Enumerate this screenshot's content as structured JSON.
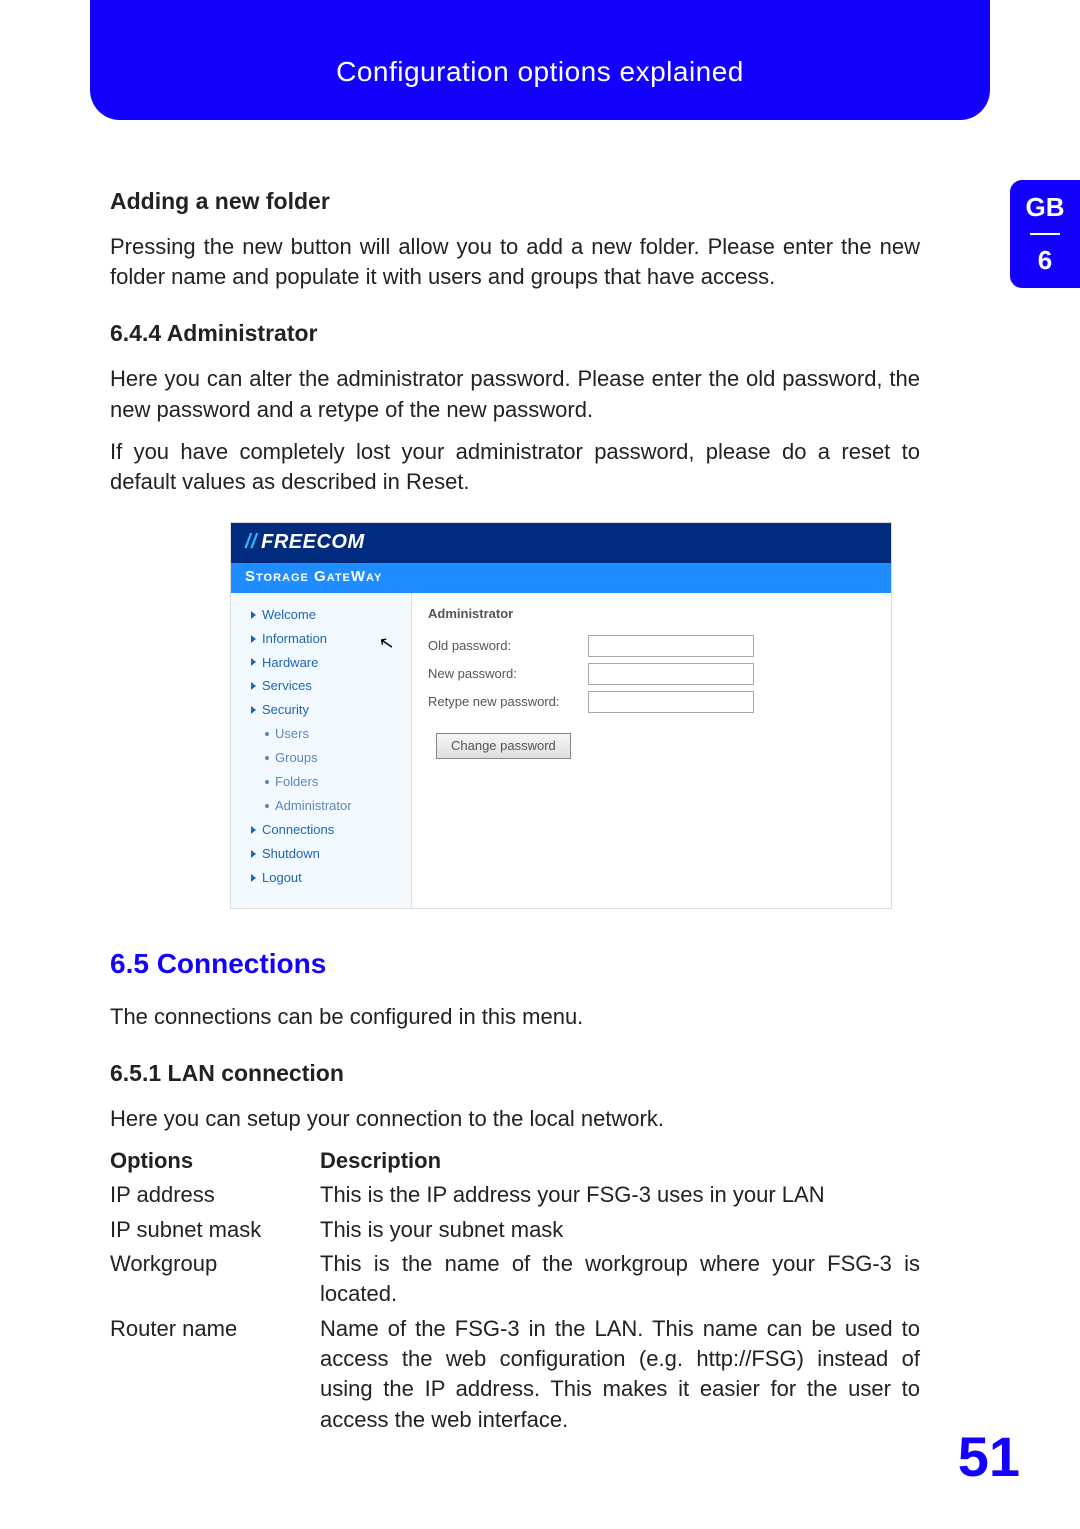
{
  "banner_title": "Configuration options explained",
  "side_tab": {
    "lang": "GB",
    "chapter": "6"
  },
  "sec1": {
    "heading": "Adding a new folder",
    "p1": "Pressing the new button will allow you to add a new folder. Please enter the new folder name and populate it with users and groups that have access."
  },
  "sec2": {
    "heading": "6.4.4 Administrator",
    "p1": "Here you can alter the administrator password. Please enter the old password, the new password and a retype of the new password.",
    "p2": "If you have completely lost your administrator password, please do a reset to default values as described in Reset."
  },
  "embedded": {
    "brand": "FREECOM",
    "tagline": "Storage GateWay",
    "sidebar": {
      "welcome": "Welcome",
      "information": "Information",
      "hardware": "Hardware",
      "services": "Services",
      "security": "Security",
      "users": "Users",
      "groups": "Groups",
      "folders": "Folders",
      "administrator": "Administrator",
      "connections": "Connections",
      "shutdown": "Shutdown",
      "logout": "Logout"
    },
    "panel": {
      "title": "Administrator",
      "old_label": "Old password:",
      "new_label": "New password:",
      "retype_label": "Retype new password:",
      "button": "Change password"
    }
  },
  "sec3": {
    "heading": "6.5 Connections",
    "p1": "The connections can be configured in this menu."
  },
  "sec4": {
    "heading": "6.5.1 LAN connection",
    "p1": "Here you can setup your connection to the local network."
  },
  "options_table": {
    "header_option": "Options",
    "header_desc": "Description",
    "rows": [
      {
        "opt": "IP address",
        "desc": "This is the IP address your FSG-3 uses in your LAN"
      },
      {
        "opt": "IP subnet mask",
        "desc": "This is your subnet mask"
      },
      {
        "opt": "Workgroup",
        "desc": "This is the name of the workgroup where your FSG-3 is located."
      },
      {
        "opt": "Router name",
        "desc": "Name of the FSG-3 in the LAN. This name can be used to access the web configuration (e.g. http://FSG) instead of using the IP address. This makes it easier for the user to access the web interface."
      }
    ]
  },
  "page_number": "51"
}
